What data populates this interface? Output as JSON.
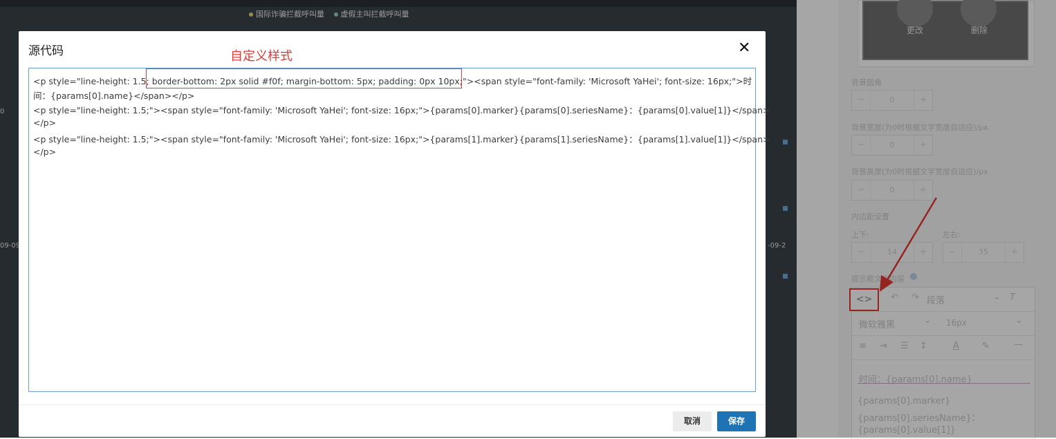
{
  "background": {
    "legend": [
      "国际诈骗拦截呼叫量",
      "虚假主叫拦截呼叫量"
    ],
    "legend_colors": [
      "#ecd57d",
      "#8fd3c5"
    ],
    "axis_labels": [
      "0",
      "09-09-",
      "-09-2"
    ]
  },
  "modal": {
    "title": "源代码",
    "annotation": "自定义样式",
    "code_lines": [
      "<p style=\"line-height: 1.5; border-bottom: 2px solid #f0f; margin-bottom: 5px; padding: 0px 10px;\"><span style=\"font-family: 'Microsoft YaHei'; font-size: 16px;\">时",
      "间：{params[0].name}</span></p>",
      "<p style=\"line-height: 1.5;\"><span style=\"font-family: 'Microsoft YaHei'; font-size: 16px;\">{params[0].marker}{params[0].seriesName}：{params[0].value[1]}</span>",
      "</p>",
      "<p style=\"line-height: 1.5;\"><span style=\"font-family: 'Microsoft YaHei'; font-size: 16px;\">{params[1].marker}{params[1].seriesName}：{params[1].value[1]}</span>",
      "</p>"
    ],
    "cancel_label": "取消",
    "save_label": "保存"
  },
  "right_panel": {
    "preview": {
      "edit_label": "更改",
      "delete_label": "删除"
    },
    "bg_radius_label": "背景圆角",
    "bg_radius_value": "0",
    "bg_width_label": "背景宽度(为0时根据文字宽度自适应)/px",
    "bg_width_value": "0",
    "bg_height_label": "背景高度(为0时根据文字宽度自适应)/px",
    "bg_height_value": "0",
    "padding_label": "内边距设置",
    "padding_vertical_label": "上下:",
    "padding_vertical_value": "14",
    "padding_horizontal_label": "左右:",
    "padding_horizontal_value": "35",
    "tooltip_content_label": "提示框文字内容",
    "editor": {
      "code_icon": "<>",
      "paragraph_select": "段落",
      "font_select": "微软雅黑",
      "size_select": "16px",
      "content": [
        "时间：{params[0].name}",
        "{params[0].marker}",
        "{params[0].seriesName}：",
        "{params[0].value[1]}"
      ]
    }
  },
  "colors": {
    "accent": "#1e73b5",
    "annotation_red": "#e53935"
  }
}
